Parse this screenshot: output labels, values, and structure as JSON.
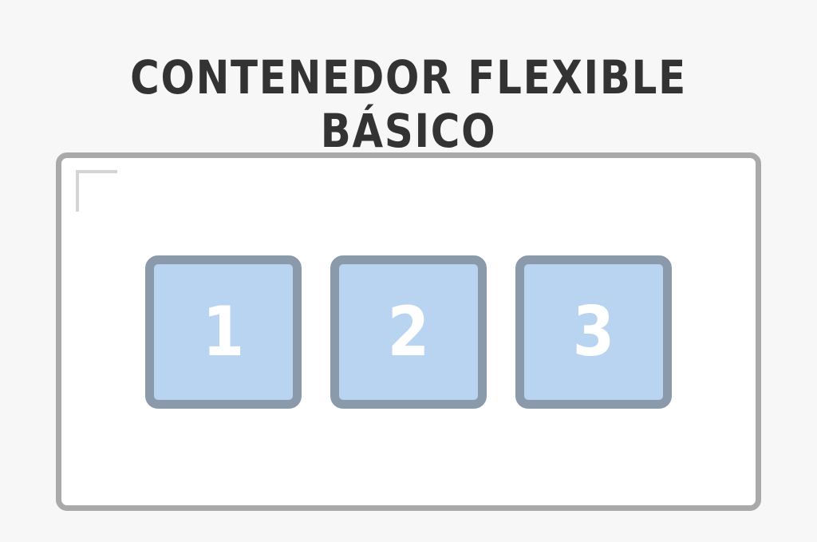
{
  "title": "CONTENEDOR FLEXIBLE BÁSICO",
  "container": {
    "items": [
      {
        "label": "1"
      },
      {
        "label": "2"
      },
      {
        "label": "3"
      }
    ]
  },
  "colors": {
    "background": "#f7f7f7",
    "title": "#333333",
    "container_border": "#a9a9a9",
    "container_fill": "#ffffff",
    "item_border": "#8a9aab",
    "item_fill": "#b8d4f1",
    "item_text": "#ffffff"
  }
}
